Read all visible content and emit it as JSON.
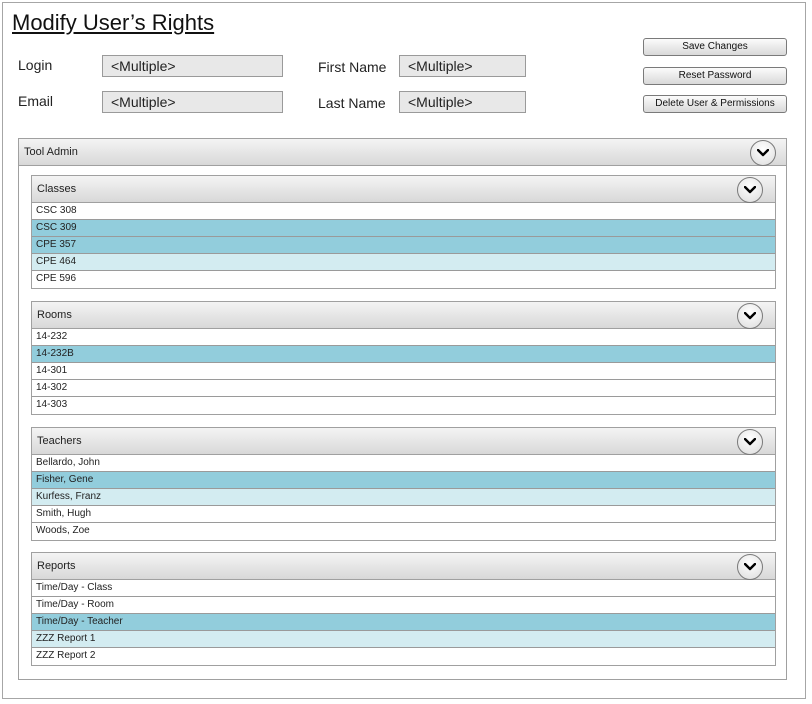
{
  "page": {
    "title": "Modify User’s Rights"
  },
  "form": {
    "login_label": "Login",
    "login_value": "<Multiple>",
    "email_label": "Email",
    "email_value": "<Multiple>",
    "first_name_label": "First Name",
    "first_name_value": "<Multiple>",
    "last_name_label": "Last Name",
    "last_name_value": "<Multiple>"
  },
  "actions": {
    "save_label": "Save Changes",
    "reset_label": "Reset Password",
    "delete_label": "Delete User & Permissions"
  },
  "tool_admin": {
    "label": "Tool Admin"
  },
  "panels": [
    {
      "label": "Classes",
      "items": [
        {
          "text": "CSC 308",
          "state": "none"
        },
        {
          "text": "CSC 309",
          "state": "selected"
        },
        {
          "text": "CPE 357",
          "state": "selected"
        },
        {
          "text": "CPE 464",
          "state": "light"
        },
        {
          "text": "CPE 596",
          "state": "none"
        }
      ]
    },
    {
      "label": "Rooms",
      "items": [
        {
          "text": "14-232",
          "state": "none"
        },
        {
          "text": "14-232B",
          "state": "selected"
        },
        {
          "text": "14-301",
          "state": "none"
        },
        {
          "text": "14-302",
          "state": "none"
        },
        {
          "text": "14-303",
          "state": "none"
        }
      ]
    },
    {
      "label": "Teachers",
      "items": [
        {
          "text": "Bellardo, John",
          "state": "none"
        },
        {
          "text": "Fisher, Gene",
          "state": "selected"
        },
        {
          "text": "Kurfess, Franz",
          "state": "light"
        },
        {
          "text": "Smith, Hugh",
          "state": "none"
        },
        {
          "text": "Woods, Zoe",
          "state": "none"
        }
      ]
    },
    {
      "label": "Reports",
      "items": [
        {
          "text": "Time/Day - Class",
          "state": "none"
        },
        {
          "text": "Time/Day - Room",
          "state": "none"
        },
        {
          "text": "Time/Day - Teacher",
          "state": "selected"
        },
        {
          "text": "ZZZ Report 1",
          "state": "light"
        },
        {
          "text": "ZZZ Report 2",
          "state": "none"
        }
      ]
    }
  ],
  "icons": {
    "collapse": "chevron-down-icon"
  },
  "colors": {
    "selected": "#92cddc",
    "light": "#d3ecf1"
  }
}
